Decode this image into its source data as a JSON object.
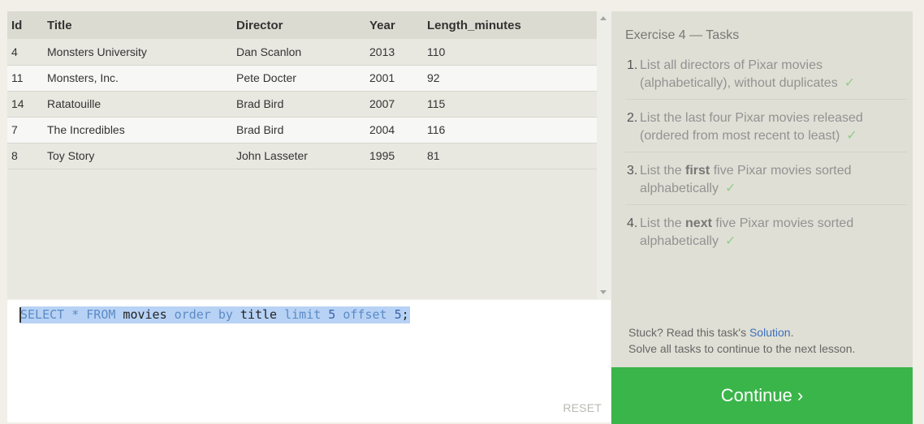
{
  "results": {
    "columns": [
      "Id",
      "Title",
      "Director",
      "Year",
      "Length_minutes"
    ],
    "rows": [
      {
        "id": "4",
        "title": "Monsters University",
        "director": "Dan Scanlon",
        "year": "2013",
        "length": "110"
      },
      {
        "id": "11",
        "title": "Monsters, Inc.",
        "director": "Pete Docter",
        "year": "2001",
        "length": "92"
      },
      {
        "id": "14",
        "title": "Ratatouille",
        "director": "Brad Bird",
        "year": "2007",
        "length": "115"
      },
      {
        "id": "7",
        "title": "The Incredibles",
        "director": "Brad Bird",
        "year": "2004",
        "length": "116"
      },
      {
        "id": "8",
        "title": "Toy Story",
        "director": "John Lasseter",
        "year": "1995",
        "length": "81"
      }
    ]
  },
  "editor": {
    "tokens": [
      {
        "text": "SELECT",
        "kind": "kw"
      },
      {
        "text": " * ",
        "kind": "kw"
      },
      {
        "text": "FROM",
        "kind": "kw"
      },
      {
        "text": " movies ",
        "kind": "id"
      },
      {
        "text": "order by",
        "kind": "kw"
      },
      {
        "text": " title ",
        "kind": "id"
      },
      {
        "text": "limit",
        "kind": "kw"
      },
      {
        "text": " 5 ",
        "kind": "num"
      },
      {
        "text": "offset",
        "kind": "kw"
      },
      {
        "text": " 5",
        "kind": "num"
      },
      {
        "text": ";",
        "kind": "id"
      }
    ],
    "reset_label": "RESET"
  },
  "tasks": {
    "title": "Exercise 4 — Tasks",
    "items": [
      {
        "num": "1.",
        "before": "List all directors of Pixar movies (alphabetically), without duplicates",
        "bold": "",
        "after": "",
        "check": "✓"
      },
      {
        "num": "2.",
        "before": "List the last four Pixar movies released (ordered from most recent to least)",
        "bold": "",
        "after": "",
        "check": "✓"
      },
      {
        "num": "3.",
        "before": "List the ",
        "bold": "first",
        "after": " five Pixar movies sorted alphabetically",
        "check": "✓"
      },
      {
        "num": "4.",
        "before": "List the ",
        "bold": "next",
        "after": " five Pixar movies sorted alphabetically",
        "check": "✓"
      }
    ],
    "stuck_prefix": "Stuck? Read this task's ",
    "solution_link": "Solution",
    "stuck_suffix": ".",
    "solve_all": "Solve all tasks to continue to the next lesson."
  },
  "continue_label": "Continue ›",
  "colors": {
    "continue": "#3ab54a",
    "check": "#8fce8d",
    "link": "#3a6fbd",
    "keyword": "#5c8bc4"
  }
}
